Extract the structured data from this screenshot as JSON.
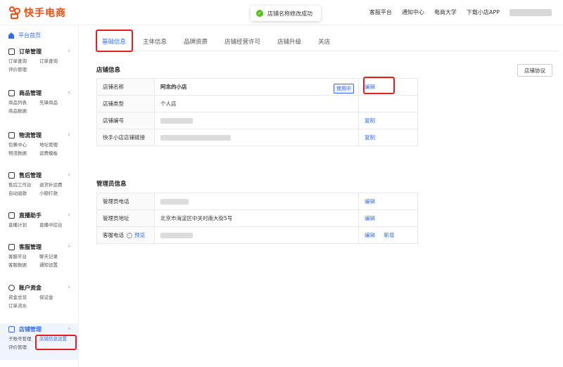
{
  "app": {
    "logo_text": "快手电商"
  },
  "topnav": {
    "items": [
      "客服平台",
      "通知中心",
      "电商大学",
      "下载小店APP"
    ]
  },
  "toast": {
    "text": "店铺名称修改成功",
    "icon": "check-circle-icon"
  },
  "sidebar": {
    "home": "平台首页",
    "groups": [
      {
        "title": "订单管理",
        "items": [
          "订单查询",
          "订单查询",
          "评价管理"
        ]
      },
      {
        "title": "商品管理",
        "items": [
          "商品列表",
          "先锋商品",
          "商品数据"
        ]
      },
      {
        "title": "物流管理",
        "items": [
          "包裹中心",
          "地址管理",
          "物流数据",
          "运费模板"
        ]
      },
      {
        "title": "售后管理",
        "items": [
          "售后工作台",
          "退货补运费",
          "自动退款",
          "小额打款"
        ]
      },
      {
        "title": "直播助手",
        "items": [
          "直播计划",
          "直播中控台"
        ]
      },
      {
        "title": "客服管理",
        "items": [
          "客服平台",
          "聊天记录",
          "客服数据",
          "通知设置"
        ]
      },
      {
        "title": "账户资金",
        "items": [
          "资金总览",
          "保证金",
          "订单流水"
        ]
      },
      {
        "title": "店铺管理",
        "items": [
          "子账号管理",
          "店铺信息设置",
          "评价管理"
        ]
      }
    ]
  },
  "tabs": [
    "基础信息",
    "主体信息",
    "品牌资质",
    "店铺经营许可",
    "店铺升级",
    "关店"
  ],
  "store_info": {
    "title": "店铺信息",
    "protocol_button": "店铺协议",
    "rows": [
      {
        "label": "店铺名称",
        "value": "阿念的小店",
        "badge": "使用中",
        "actions": [
          "编辑"
        ]
      },
      {
        "label": "店铺类型",
        "value": "个人店",
        "actions": []
      },
      {
        "label": "店铺编号",
        "value": "",
        "actions": [
          "复制"
        ]
      },
      {
        "label": "快手小店店铺链接",
        "value": "",
        "actions": [
          "复制"
        ]
      }
    ]
  },
  "admin_info": {
    "title": "管理员信息",
    "rows": [
      {
        "label": "管理员电话",
        "value": "",
        "actions": [
          "编辑"
        ]
      },
      {
        "label": "管理员地址",
        "value": "北京市海淀区中关村南大街5号",
        "actions": [
          "编辑"
        ]
      },
      {
        "label": "客服电话",
        "preview": "预览",
        "value": "",
        "actions": [
          "编辑",
          "新增"
        ]
      }
    ]
  }
}
